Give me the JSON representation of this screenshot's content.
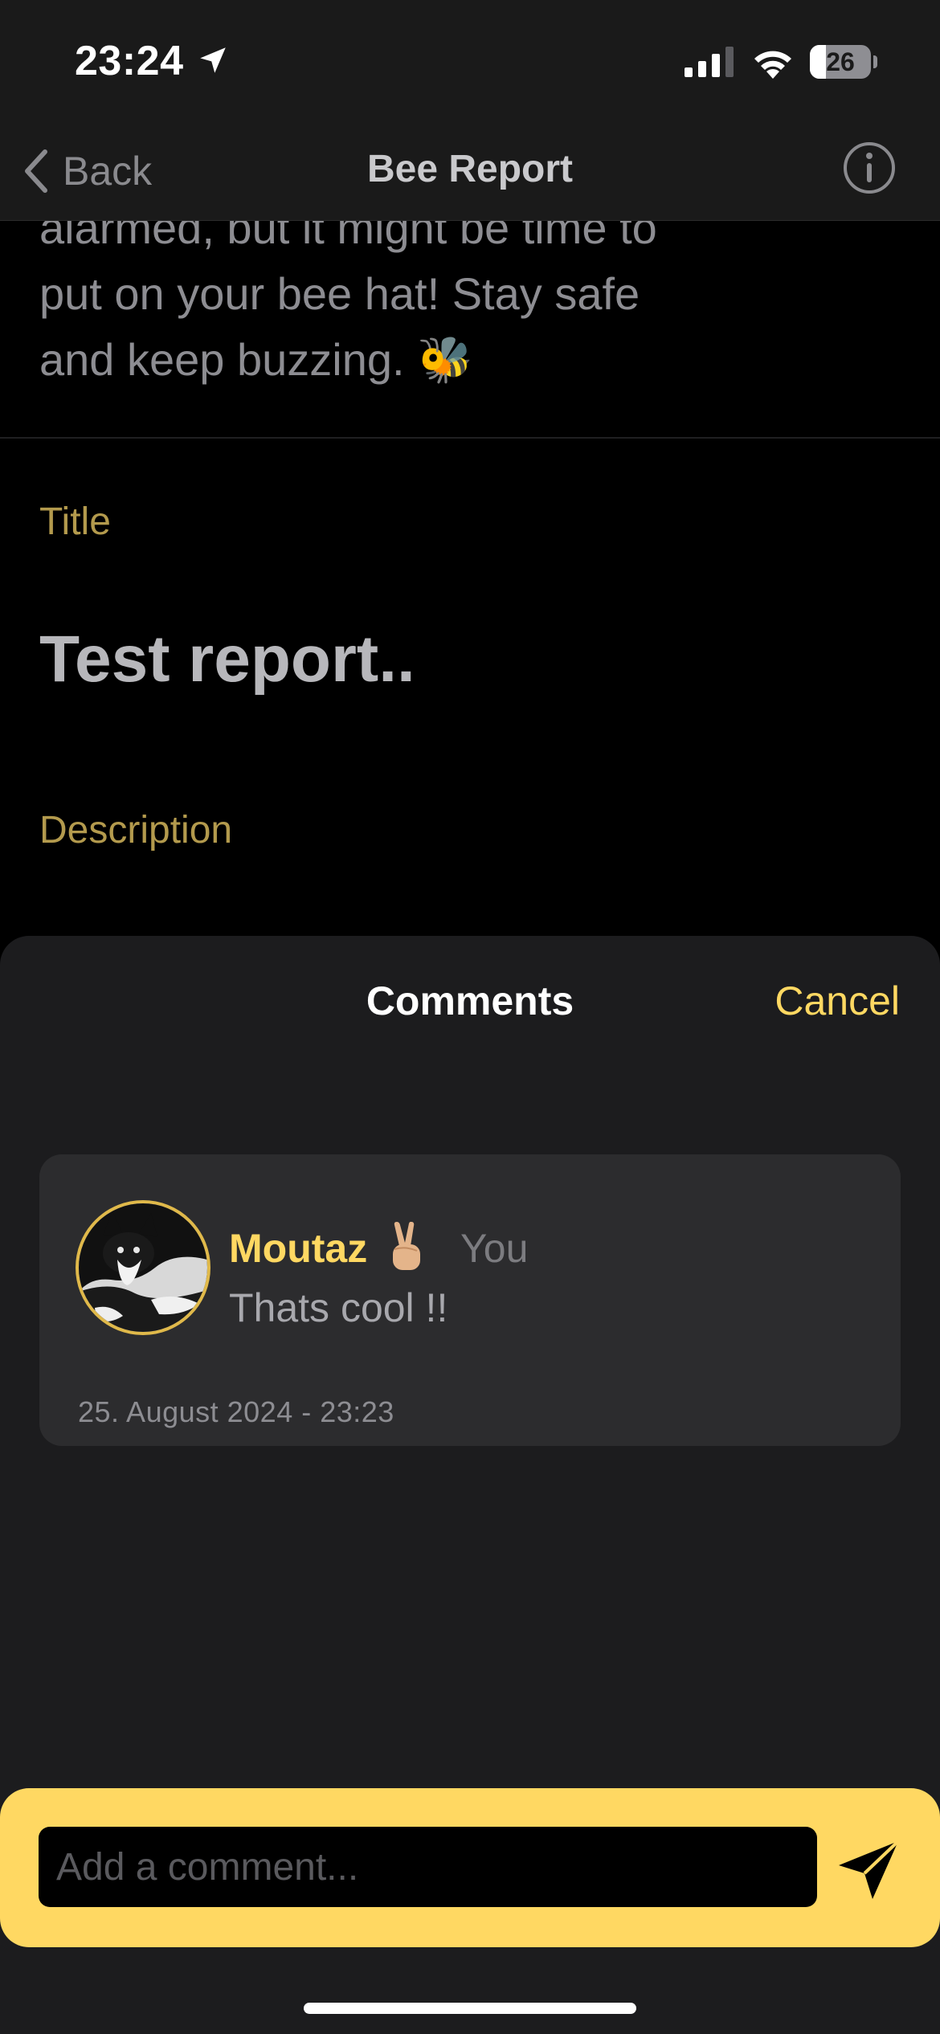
{
  "status_bar": {
    "time": "23:24",
    "battery_level": "26",
    "battery_fraction": 0.26,
    "location_icon": "location-arrow-icon",
    "signal_icon": "cellular-signal-icon",
    "wifi_icon": "wifi-icon"
  },
  "nav": {
    "back_label": "Back",
    "title": "Bee Report",
    "back_icon": "chevron-left-icon",
    "info_icon": "info-circle-icon"
  },
  "report": {
    "body_text_lines": [
      "alarmed, but it might be time to",
      "put on your bee hat! Stay safe",
      "and keep buzzing. 🐝"
    ],
    "title_label": "Title",
    "title_value": "Test report..",
    "description_label": "Description"
  },
  "comments_sheet": {
    "title": "Comments",
    "cancel_label": "Cancel",
    "comments": [
      {
        "author": "Moutaz",
        "author_emoji": "✌🏼",
        "you_label": "You",
        "text": "Thats cool !!",
        "date": "25. August 2024 - 23:23"
      }
    ]
  },
  "composer": {
    "placeholder": "Add a comment...",
    "value": "",
    "send_icon": "paper-plane-send-icon"
  },
  "colors": {
    "accent": "#ffd862",
    "accent_dim": "#b39a4d",
    "sheet_bg": "#1c1c1e",
    "card_bg": "#2c2c2e",
    "nav_bg": "#1a1a1a"
  }
}
